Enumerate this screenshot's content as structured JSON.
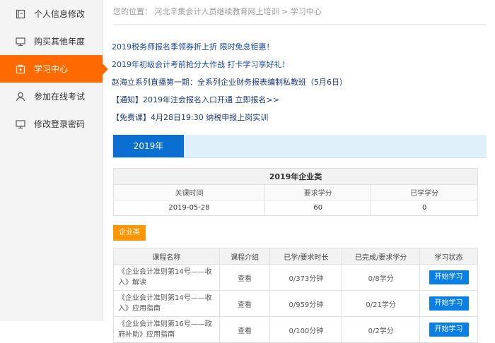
{
  "sidebar": {
    "items": [
      {
        "label": "个人信息修改",
        "icon": "profile-edit-icon"
      },
      {
        "label": "购买其他年度",
        "icon": "monitor-icon"
      },
      {
        "label": "学习中心",
        "icon": "study-center-icon",
        "active": true
      },
      {
        "label": "参加在线考试",
        "icon": "user-icon"
      },
      {
        "label": "修改登录密码",
        "icon": "monitor-icon"
      }
    ]
  },
  "breadcrumb": {
    "prefix": "您的位置：",
    "path": "河北辛集会计人员继续教育网上培训 > 学习中心"
  },
  "notices": [
    "2019税务师报名季领券折上折 限时免息钜惠！",
    "2019年初级会计考前抢分大作战 打卡学习享好礼！",
    "赵海立系列直播第一期：全系列企业财务报表编制私教班（5月6日）",
    "【通知】2019年注会报名入口开通 立即报名>>",
    "【免费课】4月28日19:30 纳税申报上岗实训"
  ],
  "year_tab": "2019年",
  "summary": {
    "caption": "2019年企业类",
    "headers": [
      "关课时间",
      "要求学分",
      "已学学分"
    ],
    "values": [
      "2019-05-28",
      "60",
      "0"
    ]
  },
  "category_button": "企业类",
  "courses": {
    "headers": [
      "课程名称",
      "课程介绍",
      "已学/要求时长",
      "已完成/要求学分",
      "学习状态"
    ],
    "rows": [
      {
        "name": "《企业会计准则第14号——收入》解读",
        "intro": "查看",
        "duration": "0/373分钟",
        "credits": "0/8学分",
        "action": "开始学习"
      },
      {
        "name": "《企业会计准则第14号——收入》应用指南",
        "intro": "查看",
        "duration": "0/959分钟",
        "credits": "0/21学分",
        "action": "开始学习"
      },
      {
        "name": "《企业会计准则第16号——政府补助》应用指南",
        "intro": "查看",
        "duration": "0/100分钟",
        "credits": "0/2学分",
        "action": "开始学习"
      }
    ]
  },
  "colors": {
    "accent": "#ff6a00",
    "link": "#1546a8",
    "primary_button": "#0a7fe6",
    "category": "#ff9500"
  }
}
